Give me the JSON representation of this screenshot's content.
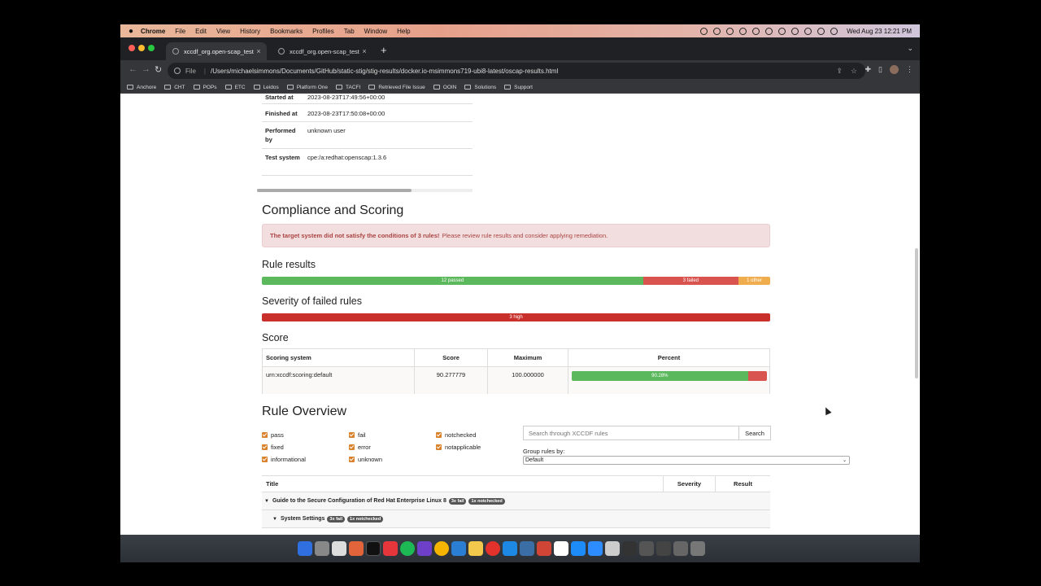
{
  "menubar": {
    "apple": "",
    "items": [
      "Chrome",
      "File",
      "Edit",
      "View",
      "History",
      "Bookmarks",
      "Profiles",
      "Tab",
      "Window",
      "Help"
    ],
    "clock": "Wed Aug 23  12:21 PM"
  },
  "tabs": [
    {
      "label": "xccdf_org.open-scap_testres"
    },
    {
      "label": "xccdf_org.open-scap_testres"
    }
  ],
  "toolbar": {
    "scheme": "File",
    "url": "/Users/michaelsimmons/Documents/GitHub/static-stig/stig-results/docker.io-msimmons719-ubi8-latest/oscap-results.html"
  },
  "bookmarks": [
    "Anchore",
    "CHT",
    "POPs",
    "ETC",
    "Leidos",
    "Platform One",
    "TACFI",
    "Retrieved File Issue",
    "OOIN",
    "Solutions",
    "Support"
  ],
  "info": [
    {
      "key": "Started at",
      "value": "2023-08-23T17:49:56+00:00"
    },
    {
      "key": "Finished at",
      "value": "2023-08-23T17:50:08+00:00"
    },
    {
      "key": "Performed by",
      "value": "unknown user"
    },
    {
      "key": "Test system",
      "value": "cpe:/a:redhat:openscap:1.3.6"
    }
  ],
  "compliance": {
    "title": "Compliance and Scoring",
    "alert_bold": "The target system did not satisfy the conditions of 3 rules!",
    "alert_rest": "Please review rule results and consider applying remediation."
  },
  "rule_results": {
    "title": "Rule results",
    "passed": 12,
    "failed": 3,
    "other": 1,
    "passed_label": "12 passed",
    "failed_label": "3 failed",
    "other_label": "1 other"
  },
  "severity": {
    "title": "Severity of failed rules",
    "high": 3,
    "high_label": "3 high"
  },
  "score": {
    "title": "Score",
    "headers": [
      "Scoring system",
      "Score",
      "Maximum",
      "Percent"
    ],
    "row": {
      "system": "urn:xccdf:scoring:default",
      "score": "90.277779",
      "maximum": "100.000000",
      "percent": 90.28,
      "percent_label": "90.28%"
    }
  },
  "overview": {
    "title": "Rule Overview",
    "filters": [
      "pass",
      "fixed",
      "informational",
      "fail",
      "error",
      "unknown",
      "notchecked",
      "notapplicable"
    ],
    "search_placeholder": "Search through XCCDF rules",
    "search_button": "Search",
    "group_label": "Group rules by:",
    "group_value": "Default",
    "table_headers": [
      "Title",
      "Severity",
      "Result"
    ],
    "groups": [
      {
        "title": "Guide to the Secure Configuration of Red Hat Enterprise Linux 8",
        "badges": [
          "3x fail",
          "1x notchecked"
        ]
      },
      {
        "title": "System Settings",
        "badges": [
          "3x fail",
          "1x notchecked"
        ]
      }
    ]
  },
  "colors": {
    "pass": "#5cb85c",
    "fail": "#d9534f",
    "other": "#f0ad4e"
  }
}
